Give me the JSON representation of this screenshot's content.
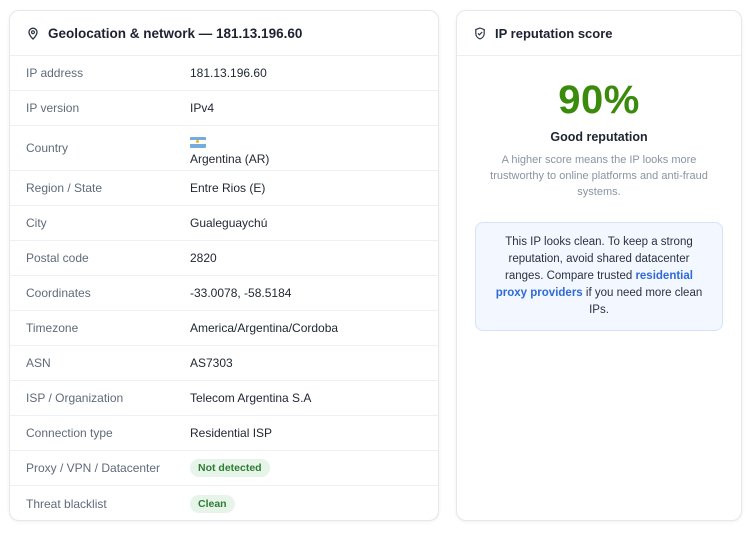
{
  "geo_card": {
    "title": "Geolocation & network — 181.13.196.60",
    "header_icon": "location-pin-icon",
    "rows": [
      {
        "label": "IP address",
        "value": "181.13.196.60"
      },
      {
        "label": "IP version",
        "value": "IPv4"
      },
      {
        "label": "Country",
        "value": "Argentina (AR)",
        "flag": "argentina-flag-icon"
      },
      {
        "label": "Region / State",
        "value": "Entre Rios (E)"
      },
      {
        "label": "City",
        "value": "Gualeguaychú"
      },
      {
        "label": "Postal code",
        "value": "2820"
      },
      {
        "label": "Coordinates",
        "value": "-33.0078, -58.5184"
      },
      {
        "label": "Timezone",
        "value": "America/Argentina/Cordoba"
      },
      {
        "label": "ASN",
        "value": "AS7303"
      },
      {
        "label": "ISP / Organization",
        "value": "Telecom Argentina S.A"
      },
      {
        "label": "Connection type",
        "value": "Residential ISP"
      },
      {
        "label": "Proxy / VPN / Datacenter",
        "value": "Not detected",
        "badge": true
      },
      {
        "label": "Threat blacklist",
        "value": "Clean",
        "badge": true
      }
    ]
  },
  "rep_card": {
    "title": "IP reputation score",
    "header_icon": "shield-check-icon",
    "score": "90%",
    "score_value": 90,
    "score_label": "Good reputation",
    "description": "A higher score means the IP looks more trustworthy to online platforms and anti-fraud systems.",
    "tip_text_before": "This IP looks clean. To keep a strong reputation, avoid shared datacenter ranges. Compare trusted ",
    "tip_link": "residential proxy providers",
    "tip_text_after": " if you need more clean IPs."
  },
  "colors": {
    "score": "#3a8a0c",
    "badge_bg": "#e6f4ea",
    "badge_text": "#2e7d32",
    "link": "#2f6bd8",
    "tip_bg": "#f3f7ff"
  }
}
